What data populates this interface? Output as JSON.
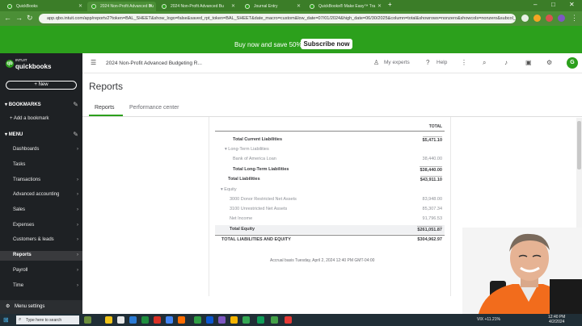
{
  "browser": {
    "tabs": [
      {
        "title": "QuickBooks",
        "active": false
      },
      {
        "title": "2024 Non-Profit Advanced Bu",
        "active": true
      },
      {
        "title": "2024 Non-Profit Advanced Bu",
        "active": false
      },
      {
        "title": "Journal Entry",
        "active": false
      },
      {
        "title": "QuickBooks® Make Easy™ Tra",
        "active": false
      }
    ],
    "url": "app.qbo.intuit.com/app/reportv2?token=BAL_SHEET&show_logo=false&saved_rpt_token=BAL_SHEET&date_macro=custom&low_date=07/01/2024&high_date=06/30/2025&column=total&showrows=nonzero&showcols=nonzero&subcol_pp="
  },
  "promo": {
    "text": "Buy now and save 50%",
    "button": "Subscribe now"
  },
  "sidebar": {
    "logo_intuit": "INTUIT",
    "logo_name": "quickbooks",
    "new_label": "+ New",
    "bookmarks_label": "BOOKMARKS",
    "add_bookmark": "Add a bookmark",
    "menu_label": "MENU",
    "items": [
      {
        "label": "Dashboards",
        "chevron": true
      },
      {
        "label": "Tasks",
        "chevron": false
      },
      {
        "label": "Transactions",
        "chevron": true
      },
      {
        "label": "Advanced accounting",
        "chevron": true
      },
      {
        "label": "Sales",
        "chevron": true
      },
      {
        "label": "Expenses",
        "chevron": true
      },
      {
        "label": "Customers & leads",
        "chevron": true
      },
      {
        "label": "Reports",
        "chevron": true,
        "selected": true
      },
      {
        "label": "Payroll",
        "chevron": true
      },
      {
        "label": "Time",
        "chevron": true
      }
    ],
    "settings_label": "Menu settings"
  },
  "topnav": {
    "company": "2024 Non-Profit Advanced Budgeting R...",
    "my_experts": "My experts",
    "help": "Help",
    "avatar": "G"
  },
  "page": {
    "title": "Reports",
    "tabs": [
      "Reports",
      "Performance center"
    ]
  },
  "report": {
    "column_header": "TOTAL",
    "rows": [
      {
        "label": "Total Current Liabilities",
        "amount": "$5,471.10",
        "indent": 2,
        "style": "total"
      },
      {
        "label": "▾ Long-Term Liabilities",
        "amount": "",
        "indent": 1,
        "style": "header"
      },
      {
        "label": "Bank of America Loan",
        "amount": "38,440.00",
        "indent": 2,
        "style": "muted"
      },
      {
        "label": "Total Long-Term Liabilities",
        "amount": "$38,440.00",
        "indent": 2,
        "style": "total"
      },
      {
        "label": "Total Liabilities",
        "amount": "$43,911.10",
        "indent": 1,
        "style": "total"
      },
      {
        "label": "▾ Equity",
        "amount": "",
        "indent": 0,
        "style": "header"
      },
      {
        "label": "3000 Donor Restricted Net Assets",
        "amount": "83,948.00",
        "indent": 1,
        "style": "muted"
      },
      {
        "label": "3100 Unrestricted Net Assets",
        "amount": "85,307.34",
        "indent": 1,
        "style": "muted"
      },
      {
        "label": "Net Income",
        "amount": "91,796.53",
        "indent": 1,
        "style": "muted"
      },
      {
        "label": "Total Equity",
        "amount": "$261,051.87",
        "indent": 1,
        "style": "total-hl"
      },
      {
        "label": "TOTAL LIABILITIES AND EQUITY",
        "amount": "$304,962.97",
        "indent": 0,
        "style": "grand"
      }
    ],
    "footer": "Accrual basis  Tuesday, April 2, 2024   12:40 PM GMT-04:00"
  },
  "taskbar": {
    "search_placeholder": "Type here to search",
    "weather": "VIX  +11.21%",
    "time": "12:40 PM",
    "date": "4/2/2024"
  }
}
